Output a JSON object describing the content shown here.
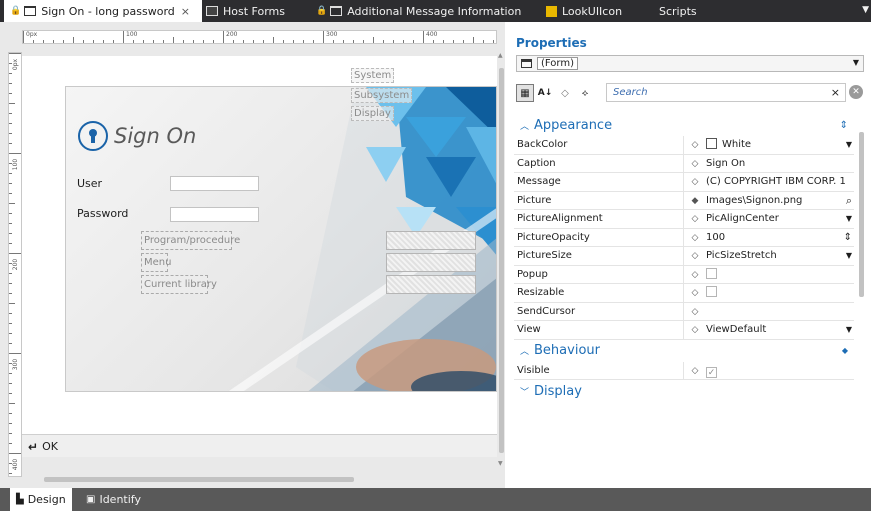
{
  "tabs": [
    {
      "label": "Sign On - long password",
      "icon": "window-icon",
      "locked": true,
      "active": true
    },
    {
      "label": "Host Forms",
      "icon": "host-forms-icon",
      "locked": false,
      "active": false
    },
    {
      "label": "Additional Message Information",
      "icon": "window-icon",
      "locked": true,
      "active": false
    },
    {
      "label": "LookUIIcon",
      "icon": "image-icon",
      "locked": false,
      "active": false
    },
    {
      "label": "Scripts",
      "icon": "",
      "locked": false,
      "active": false
    }
  ],
  "tab_close": "×",
  "tab_overflow": "▼",
  "ruler": {
    "top_labels": [
      "0px",
      "100",
      "200",
      "300",
      "400"
    ],
    "left_labels": [
      "0px",
      "100",
      "200",
      "300",
      "400"
    ]
  },
  "form": {
    "title": "Sign On",
    "user_label": "User",
    "password_label": "Password",
    "fields": [
      "Program/procedure",
      "Menu",
      "Current library"
    ],
    "system_labels": [
      "System",
      "Subsystem",
      "Display"
    ],
    "ok_key": "↵",
    "ok_label": "OK"
  },
  "properties": {
    "title": "Properties",
    "object": "(Form)",
    "search_placeholder": "Search",
    "search_clear": "×",
    "search_go": "✕",
    "categories": [
      {
        "name": "Appearance",
        "expanded": true,
        "rows": [
          {
            "name": "BackColor",
            "value": "White",
            "swatch": "#ffffff",
            "action": "▼"
          },
          {
            "name": "Caption",
            "value": "Sign On",
            "action": ""
          },
          {
            "name": "Message",
            "value": "(C) COPYRIGHT IBM CORP. 1",
            "action": ""
          },
          {
            "name": "Picture",
            "value": "Images\\Signon.png",
            "action": "⌕",
            "modified": true
          },
          {
            "name": "PictureAlignment",
            "value": "PicAlignCenter",
            "action": "▼"
          },
          {
            "name": "PictureOpacity",
            "value": "100",
            "action": "⇕"
          },
          {
            "name": "PictureSize",
            "value": "PicSizeStretch",
            "action": "▼"
          },
          {
            "name": "Popup",
            "value": "",
            "checkbox": false,
            "action": ""
          },
          {
            "name": "Resizable",
            "value": "",
            "checkbox": false,
            "action": ""
          },
          {
            "name": "SendCursor",
            "value": "",
            "action": ""
          },
          {
            "name": "View",
            "value": "ViewDefault",
            "action": "▼"
          }
        ]
      },
      {
        "name": "Behaviour",
        "expanded": true,
        "rows": [
          {
            "name": "Visible",
            "value": "",
            "checkbox": true,
            "action": ""
          }
        ]
      },
      {
        "name": "Display",
        "expanded": false,
        "rows": []
      }
    ]
  },
  "bottom_tabs": [
    {
      "label": "Design",
      "active": true
    },
    {
      "label": "Identify",
      "active": false
    }
  ],
  "colors": {
    "accent": "#1d6db5",
    "tab_bar": "#2d2d30",
    "status_bar": "#595959"
  }
}
